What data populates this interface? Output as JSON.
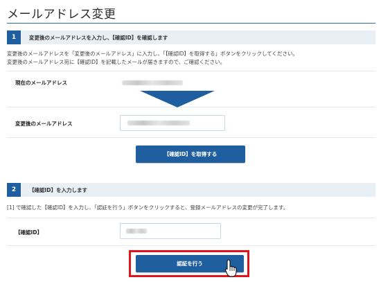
{
  "page_title": "メールアドレス変更",
  "section1": {
    "number": "1",
    "title": "変更後のメールアドレスを入力し、【確認ID】を確認します",
    "desc_line1": "変更後のメールアドレスを「変更後のメールアドレス」に入力し、「【確認ID】を取得する」ボタンをクリックしてください。",
    "desc_line2": "変更後のメールアドレス宛に【確認ID】を記載したメールが届きますので、ご確認ください。",
    "current_email_label": "現在のメールアドレス",
    "new_email_label": "変更後のメールアドレス",
    "get_id_button": "【確認ID】を取得する"
  },
  "section2": {
    "number": "2",
    "title": "【確認ID】を入力します",
    "desc": "[1] で確認した【確認ID】を入力し、「認証を行う」ボタンをクリックすると、登録メールアドレスの変更が完了します。",
    "confirm_id_label": "【確認ID】",
    "authenticate_button": "認証を行う"
  },
  "colors": {
    "accent": "#1f5f9f",
    "section_bg": "#e8eff5",
    "highlight": "#e0141e"
  }
}
